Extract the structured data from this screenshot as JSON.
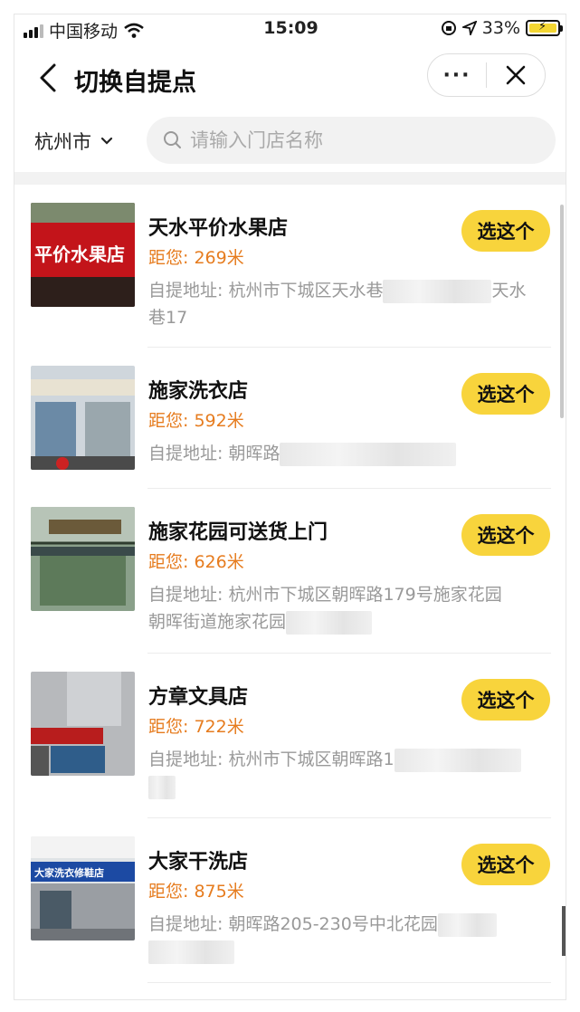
{
  "status_bar": {
    "carrier": "中国移动",
    "time": "15:09",
    "battery": "33%"
  },
  "nav": {
    "title": "切换自提点",
    "more_label": "···"
  },
  "search": {
    "city": "杭州市",
    "placeholder": "请输入门店名称"
  },
  "stores": [
    {
      "name": "天水平价水果店",
      "distance": "距您: 269米",
      "address": "自提地址: 杭州市下城区天水巷",
      "address_tail": "天水",
      "address_line2": "巷17",
      "button": "选这个"
    },
    {
      "name": "施家洗衣店",
      "distance": "距您: 592米",
      "address": "自提地址: 朝晖路",
      "address_tail": "",
      "address_line2": "",
      "button": "选这个"
    },
    {
      "name": "施家花园可送货上门",
      "distance": "距您: 626米",
      "address": "自提地址: 杭州市下城区朝晖路179号施家花园",
      "address_tail": "",
      "address_line2": "朝晖街道施家花园",
      "button": "选这个"
    },
    {
      "name": "方章文具店",
      "distance": "距您: 722米",
      "address": "自提地址: 杭州市下城区朝晖路1",
      "address_tail": "",
      "address_line2": "",
      "button": "选这个"
    },
    {
      "name": "大家干洗店",
      "distance": "距您: 875米",
      "address": "自提地址: 朝晖路205-230号中北花园",
      "address_tail": "",
      "address_line2": "",
      "button": "选这个"
    }
  ],
  "thumb_signs": [
    "平价水果店",
    "",
    "",
    "",
    "大家洗衣修鞋店"
  ],
  "colors": {
    "accent": "#f8d43c",
    "distance": "#e67c1f"
  }
}
